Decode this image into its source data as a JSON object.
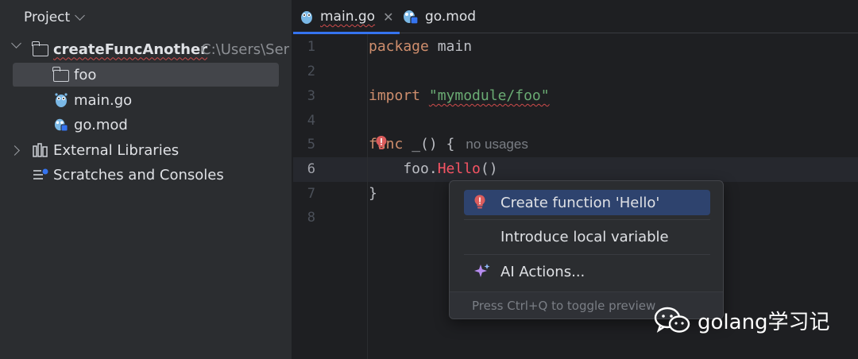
{
  "project_panel": {
    "title": "Project",
    "root": {
      "name": "createFuncAnother",
      "path": "C:\\Users\\Ser"
    },
    "items": [
      {
        "label": "foo",
        "icon": "folder-icon"
      },
      {
        "label": "main.go",
        "icon": "gopher-icon"
      },
      {
        "label": "go.mod",
        "icon": "gomod-icon"
      }
    ],
    "external_libraries": "External Libraries",
    "scratches": "Scratches and Consoles"
  },
  "tabs": [
    {
      "label": "main.go",
      "active": true,
      "icon": "gopher-icon"
    },
    {
      "label": "go.mod",
      "active": false,
      "icon": "gomod-icon"
    }
  ],
  "editor": {
    "line_numbers": [
      "1",
      "2",
      "3",
      "4",
      "5",
      "6",
      "7",
      "8"
    ],
    "current_line": 6,
    "lines": {
      "l1_kw": "package",
      "l1_rest": " main",
      "l3_kw": "import",
      "l3_str": "\"mymodule/foo\"",
      "l5_kw": "func",
      "l5_rest": " _() {",
      "l5_hint": "no usages",
      "l6_pkg": "    foo.",
      "l6_fn": "Hello",
      "l6_parens": "()",
      "l7": "}"
    }
  },
  "popup": {
    "items": [
      {
        "label": "Create function 'Hello'",
        "icon": "error-bulb-icon",
        "selected": true
      },
      {
        "label": "Introduce local variable",
        "icon": "",
        "selected": false
      },
      {
        "label": "AI Actions...",
        "icon": "sparkle-icon",
        "selected": false
      }
    ],
    "footer": "Press Ctrl+Q to toggle preview"
  },
  "watermark": {
    "text": "golang学习记",
    "icon": "wechat-icon"
  },
  "colors": {
    "keyword": "#cf8e6d",
    "string": "#6aab73",
    "error": "#f75464",
    "selection": "#2e436e",
    "accent": "#3574f0"
  }
}
